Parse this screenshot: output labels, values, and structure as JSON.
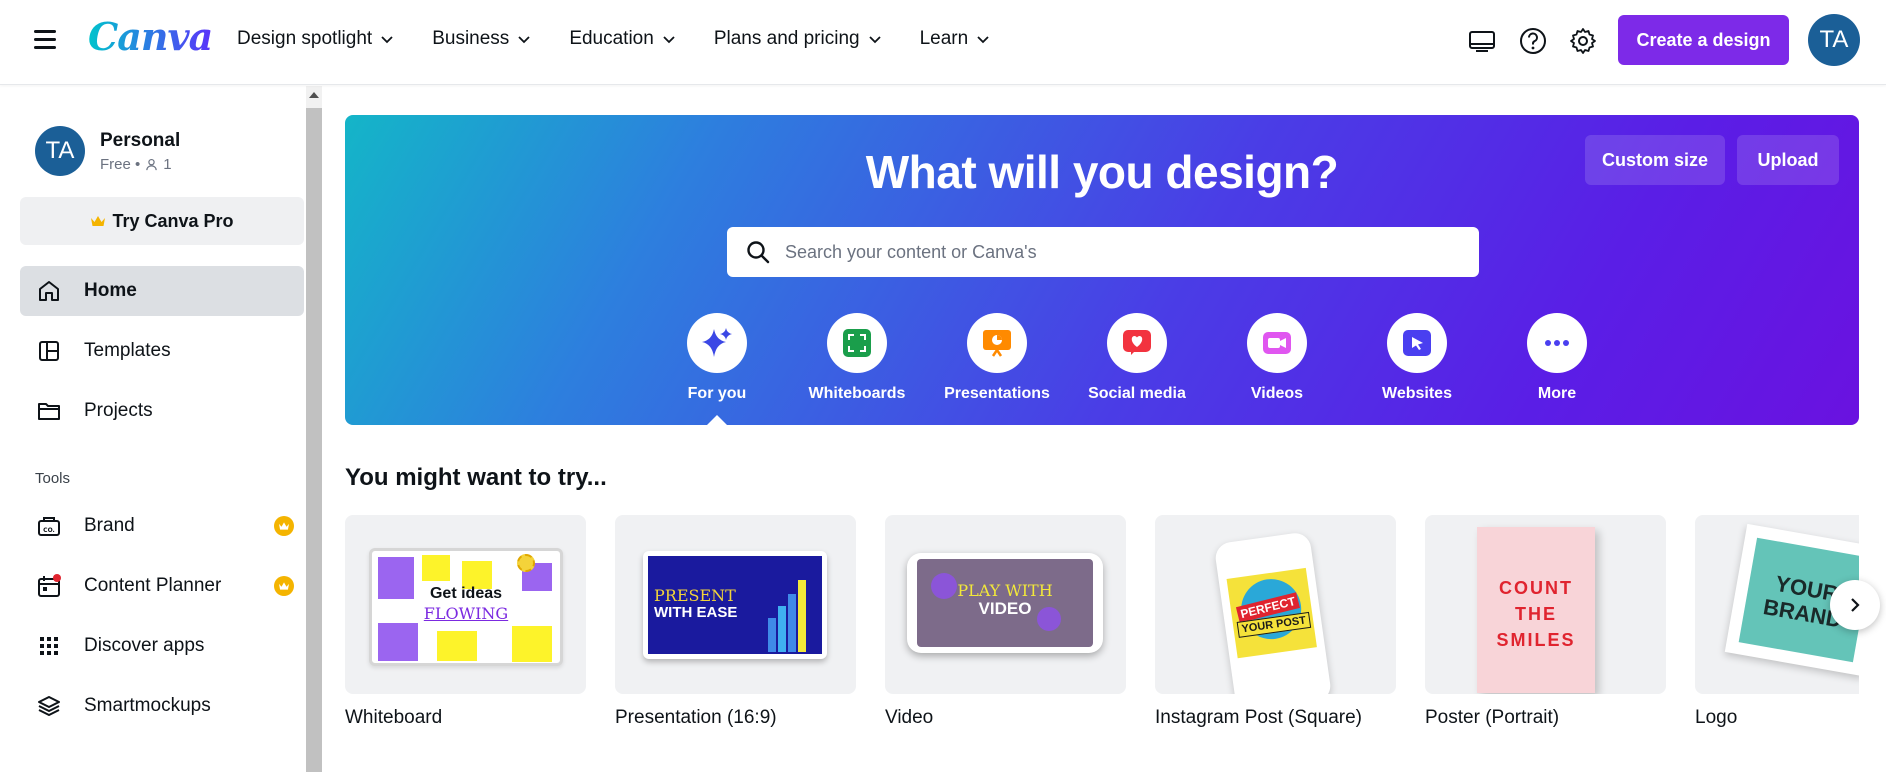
{
  "topbar": {
    "logo": "Canva",
    "nav": [
      {
        "label": "Design spotlight"
      },
      {
        "label": "Business"
      },
      {
        "label": "Education"
      },
      {
        "label": "Plans and pricing"
      },
      {
        "label": "Learn"
      }
    ],
    "create_label": "Create a design",
    "avatar_initials": "TA"
  },
  "sidebar": {
    "account_name": "Personal",
    "account_plan": "Free •",
    "account_members": "1",
    "avatar_initials": "TA",
    "try_pro_label": "Try Canva Pro",
    "items": [
      {
        "label": "Home"
      },
      {
        "label": "Templates"
      },
      {
        "label": "Projects"
      }
    ],
    "tools_heading": "Tools",
    "tools": [
      {
        "label": "Brand"
      },
      {
        "label": "Content Planner"
      },
      {
        "label": "Discover apps"
      },
      {
        "label": "Smartmockups"
      }
    ]
  },
  "hero": {
    "title": "What will you design?",
    "custom_size_label": "Custom size",
    "upload_label": "Upload",
    "search_placeholder": "Search your content or Canva's",
    "categories": [
      {
        "label": "For you",
        "icon": "sparkle-icon"
      },
      {
        "label": "Whiteboards",
        "icon": "whiteboard-icon"
      },
      {
        "label": "Presentations",
        "icon": "presentation-icon"
      },
      {
        "label": "Social media",
        "icon": "heart-icon"
      },
      {
        "label": "Videos",
        "icon": "video-camera-icon"
      },
      {
        "label": "Websites",
        "icon": "cursor-icon"
      },
      {
        "label": "More",
        "icon": "more-icon"
      }
    ]
  },
  "suggestions": {
    "title": "You might want to try...",
    "items": [
      {
        "label": "Whiteboard",
        "thumb_text": "Get ideas",
        "thumb_text2": "FLOWING"
      },
      {
        "label": "Presentation (16:9)",
        "thumb_text": "PRESENT",
        "thumb_text2": "WITH EASE"
      },
      {
        "label": "Video",
        "thumb_text": "PLAY WITH",
        "thumb_text2": "VIDEO"
      },
      {
        "label": "Instagram Post (Square)",
        "thumb_text": "PERFECT",
        "thumb_text2": "YOUR POST"
      },
      {
        "label": "Poster (Portrait)",
        "thumb_text": "COUNT THE SMILES"
      },
      {
        "label": "Logo",
        "thumb_text": "YOUR",
        "thumb_text2": "BRAND"
      }
    ]
  },
  "colors": {
    "brand_purple": "#7d2ae8",
    "avatar_blue": "#1b5f97",
    "pro_crown": "#f4b400"
  }
}
